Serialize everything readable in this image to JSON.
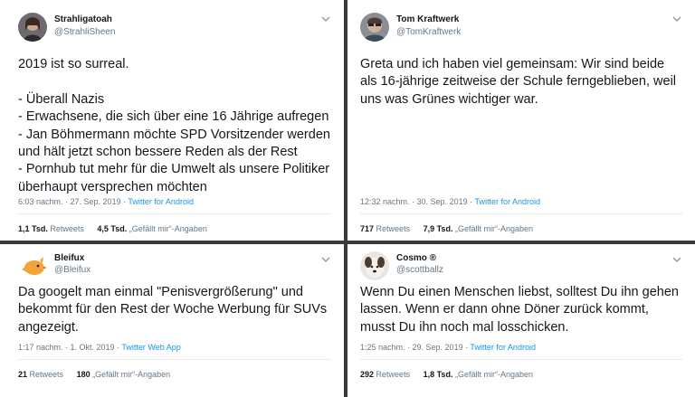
{
  "tweets": [
    {
      "name": "Strahligatoah",
      "handle": "@StrahliSheen",
      "text": "2019 ist so surreal.\n\n- Überall Nazis\n- Erwachsene, die sich über eine 16 Jährige aufregen\n- Jan Böhmermann möchte SPD Vorsitzender werden und hält jetzt schon bessere Reden als der Rest\n- Pornhub tut mehr für die Umwelt als unsere Politiker überhaupt versprechen möchten",
      "time": "6:03 nachm. · 27. Sep. 2019 ·",
      "app": "Twitter for Android",
      "retweets_count": "1,1 Tsd.",
      "retweets_label": "Retweets",
      "likes_count": "4,5 Tsd.",
      "likes_label": "„Gefällt mir“-Angaben"
    },
    {
      "name": "Tom Kraftwerk",
      "handle": "@TomKraftwerk",
      "text": "Greta und ich haben viel gemeinsam: Wir sind beide als 16-jährige zeitweise der Schule ferngeblieben, weil uns was Grünes wichtiger war.",
      "time": "12:32 nachm. · 30. Sep. 2019 ·",
      "app": "Twitter for Android",
      "retweets_count": "717",
      "retweets_label": "Retweets",
      "likes_count": "7,9 Tsd.",
      "likes_label": "„Gefällt mir“-Angaben"
    },
    {
      "name": "Bleifux",
      "handle": "@Bleifux",
      "text": "Da googelt man einmal \"Penisvergrößerung\" und bekommt für den Rest der Woche Werbung für SUVs angezeigt.",
      "time": "1:17 nachm. · 1. Okt. 2019 ·",
      "app": "Twitter Web App",
      "retweets_count": "21",
      "retweets_label": "Retweets",
      "likes_count": "180",
      "likes_label": "„Gefällt mir“-Angaben"
    },
    {
      "name": "Cosmo ®",
      "handle": "@scottballz",
      "text": "Wenn Du einen Menschen liebst, solltest Du ihn gehen lassen. Wenn er dann ohne Döner zurück kommt, musst Du ihn noch mal losschicken.",
      "time": "1:25 nachm. · 29. Sep. 2019 ·",
      "app": "Twitter for Android",
      "retweets_count": "292",
      "retweets_label": "Retweets",
      "likes_count": "1,8 Tsd.",
      "likes_label": "„Gefällt mir“-Angaben"
    }
  ],
  "icons": {
    "menu": "chevron-down-icon",
    "avatar1": "avatar-photo",
    "avatar2": "avatar-photo",
    "avatar3": "orange-fox-avatar",
    "avatar4": "dog-avatar"
  },
  "colors": {
    "link": "#1b95e0",
    "muted": "#657786",
    "text": "#14171a",
    "divider": "#3a3a3a"
  }
}
